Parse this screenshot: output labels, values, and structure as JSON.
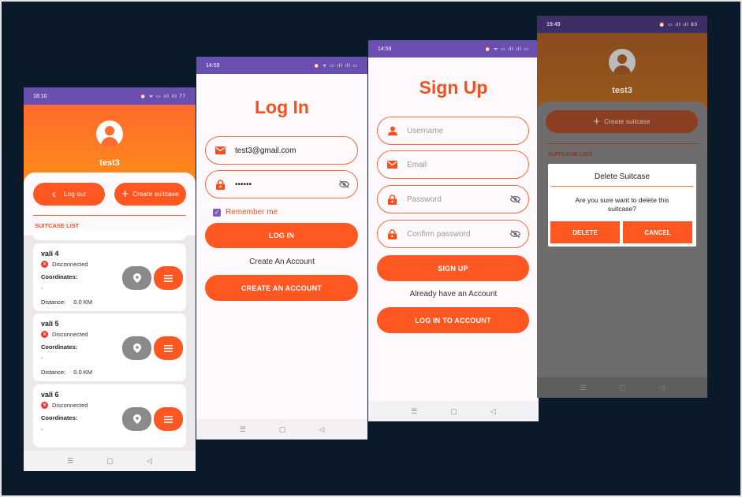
{
  "screens": {
    "home": {
      "status_time": "18:10",
      "status_icons": "⏰ ᯤ ▭ ıll ıll 77",
      "username": "test3",
      "logout_label": "Log out",
      "create_label": "Create suitcase",
      "section_label": "SUITCASE LIST",
      "items": [
        {
          "name": "vali 4",
          "status": "Disconnected",
          "coords_label": "Coordinates:",
          "coords": ",",
          "dist_label": "Distance:",
          "dist": "0.0 KM"
        },
        {
          "name": "vali 5",
          "status": "Disconnected",
          "coords_label": "Coordinates:",
          "coords": ",",
          "dist_label": "Distance:",
          "dist": "0.0 KM"
        },
        {
          "name": "vali 6",
          "status": "Disconnected",
          "coords_label": "Coordinates:",
          "coords": ","
        }
      ]
    },
    "login": {
      "status_time": "14:59",
      "status_icons": "⏰ ᯤ ▭ ıll ıll ▭",
      "title": "Log In",
      "email_value": "test3@gmail.com",
      "password_value": "••••••",
      "remember_label": "Remember me",
      "remember_checked": true,
      "login_button": "LOG IN",
      "create_text": "Create An Account",
      "create_button": "CREATE AN ACCOUNT"
    },
    "signup": {
      "status_time": "14:59",
      "status_icons": "⏰ ᯤ ▭ ıll ıll ▭",
      "title": "Sign Up",
      "username_placeholder": "Username",
      "email_placeholder": "Email",
      "password_placeholder": "Password",
      "confirm_placeholder": "Confirm password",
      "signup_button": "SIGN UP",
      "already_text": "Already have an Account",
      "login_button": "LOG IN TO ACCOUNT"
    },
    "delete_dialog": {
      "status_time": "19:49",
      "status_icons": "⏰ ▭ ıll ıll 80",
      "username": "test3",
      "create_label": "Create suitcase",
      "section_label": "SUITCASE LIST",
      "dialog_title": "Delete Suitcase",
      "dialog_message": "Are you sure want to delete this suitcase?",
      "delete_button": "DELETE",
      "cancel_button": "CANCEL"
    }
  },
  "nav_icons": {
    "menu": "☰",
    "home": "▢",
    "back": "◁"
  },
  "colors": {
    "accent": "#ff5722",
    "status_bar": "#6a4fb0",
    "background": "#0b1a2b"
  }
}
